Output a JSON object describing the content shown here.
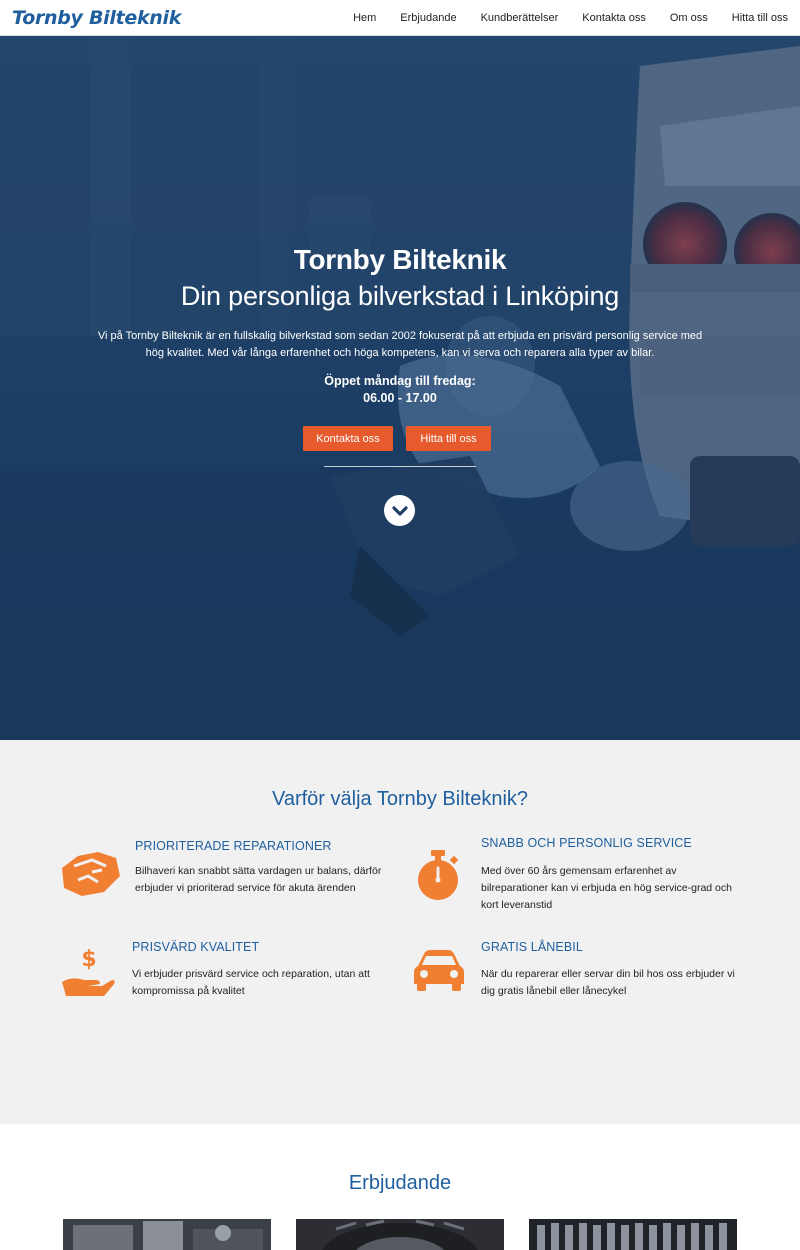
{
  "nav": {
    "logo": "Tornby Bilteknik",
    "items": [
      "Hem",
      "Erbjudande",
      "Kundberättelser",
      "Kontakta oss",
      "Om oss",
      "Hitta till oss"
    ]
  },
  "hero": {
    "title": "Tornby Bilteknik",
    "subtitle": "Din personliga bilverkstad i Linköping",
    "description": "Vi på Tornby Bilteknik är en fullskalig bilverkstad som sedan 2002 fokuserat på att erbjuda en prisvärd personlig service med hög kvalitet. Med vår långa erfarenhet och höga kompetens, kan vi serva och reparera alla typer av bilar.",
    "open_label": "Öppet måndag till fredag:",
    "hours": "06.00 - 17.00",
    "btn_contact": "Kontakta oss",
    "btn_find": "Hitta till oss",
    "scroll_icon": "chevron-down-icon"
  },
  "why": {
    "title": "Varför välja Tornby Bilteknik?",
    "features": [
      {
        "icon": "handshake-icon",
        "title": "PRIORITERADE REPARATIONER",
        "text": "Bilhaveri kan snabbt sätta vardagen ur balans, därför erbjuder vi prioriterad service för akuta ärenden"
      },
      {
        "icon": "stopwatch-icon",
        "title": "SNABB OCH PERSONLIG SERVICE",
        "text": "Med över 60 års gemensam erfarenhet av bilreparationer kan vi erbjuda en hög service-grad och kort leveranstid"
      },
      {
        "icon": "money-hand-icon",
        "title": "PRISVÄRD KVALITET",
        "text": "Vi erbjuder prisvärd service och reparation, utan att kompromissa på kvalitet"
      },
      {
        "icon": "car-icon",
        "title": "GRATIS LÅNEBIL",
        "text": "När du reparerar eller servar din bil hos oss erbjuder vi dig gratis lånebil eller lånecykel"
      }
    ]
  },
  "offers": {
    "title": "Erbjudande"
  },
  "colors": {
    "brand_blue": "#1f5f9e",
    "accent_orange": "#e65a2e",
    "icon_orange": "#f07f32",
    "hero_overlay": "#1d3f66",
    "section_bg": "#f1f1f2"
  }
}
